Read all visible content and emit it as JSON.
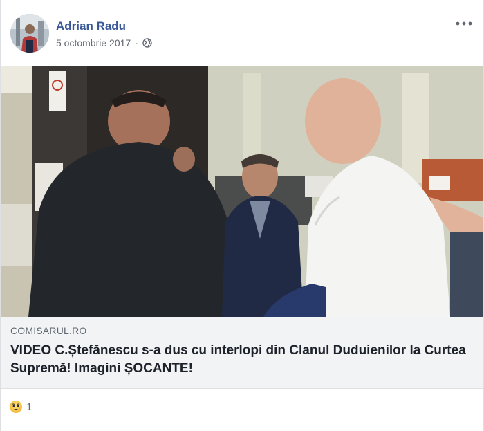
{
  "post": {
    "author": "Adrian Radu",
    "date": "5 octombrie 2017",
    "date_separator": "·",
    "privacy_icon": "globe-icon",
    "more_icon": "more-options-icon"
  },
  "link": {
    "source": "COMISARUL.RO",
    "headline": "VIDEO C.Ștefănescu s-a dus cu interlopi din Clanul Duduienilor la Curtea Supremă! Imagini ȘOCANTE!"
  },
  "reactions": {
    "icon": "sad-reaction-icon",
    "count": "1"
  },
  "colors": {
    "author_link": "#385898",
    "secondary_text": "#606770",
    "caption_bg": "#f2f3f5"
  }
}
